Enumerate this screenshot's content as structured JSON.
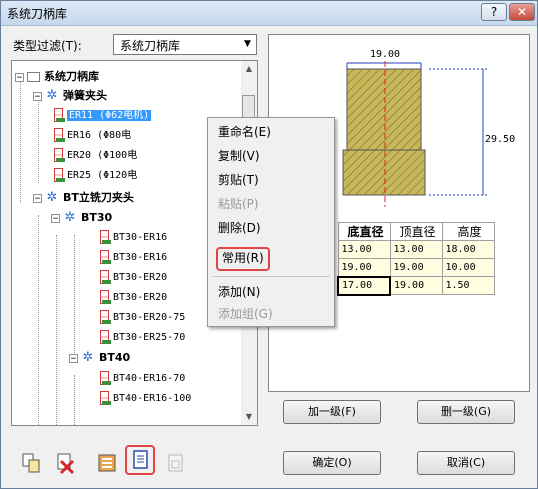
{
  "window": {
    "title": "系统刀柄库",
    "help_label": "?",
    "close_label": "✕"
  },
  "filter": {
    "label": "类型过滤(T):",
    "value": "系统刀柄库"
  },
  "tree": {
    "root": "系统刀柄库",
    "groups": [
      {
        "label": "弹簧夹头",
        "items": [
          "ER11 (Φ62电机)",
          "ER16 (Φ80电",
          "ER20 (Φ100电",
          "ER25 (Φ120电"
        ]
      },
      {
        "label": "BT立铣刀夹头",
        "subgroups": [
          {
            "label": "BT30",
            "items": [
              "BT30-ER16",
              "BT30-ER16",
              "BT30-ER20",
              "BT30-ER20",
              "BT30-ER20-75",
              "BT30-ER25-70"
            ]
          },
          {
            "label": "BT40",
            "items": [
              "BT40-ER16-70",
              "BT40-ER16-100"
            ]
          }
        ]
      }
    ]
  },
  "context_menu": {
    "items": [
      {
        "label": "重命名(E)",
        "enabled": true
      },
      {
        "label": "复制(V)",
        "enabled": true
      },
      {
        "label": "剪贴(T)",
        "enabled": true
      },
      {
        "label": "粘贴(P)",
        "enabled": false
      },
      {
        "label": "删除(D)",
        "enabled": true
      },
      {
        "label": "常用(R)",
        "enabled": true,
        "highlighted": true
      },
      {
        "label": "添加(N)",
        "enabled": true
      },
      {
        "label": "添加组(G)",
        "enabled": false
      }
    ]
  },
  "preview": {
    "width_label": "19.00",
    "height_label": "29.50",
    "table": {
      "headers": [
        "底直径",
        "顶直径",
        "高度"
      ],
      "rows": [
        [
          "13.00",
          "13.00",
          "18.00"
        ],
        [
          "19.00",
          "19.00",
          "10.00"
        ],
        [
          "17.00",
          "19.00",
          "1.50"
        ]
      ]
    }
  },
  "buttons": {
    "add_level": "加一级(F)",
    "delete_level": "删一级(G)",
    "ok": "确定(O)",
    "cancel": "取消(C)"
  },
  "colors": {
    "selection": "#3399ff",
    "highlight_border": "#e04646",
    "holder_fill": "#c8b85a",
    "cell_fill": "#fffde0",
    "dimension_line": "#1f3fbf",
    "axis_line": "#e02020"
  }
}
